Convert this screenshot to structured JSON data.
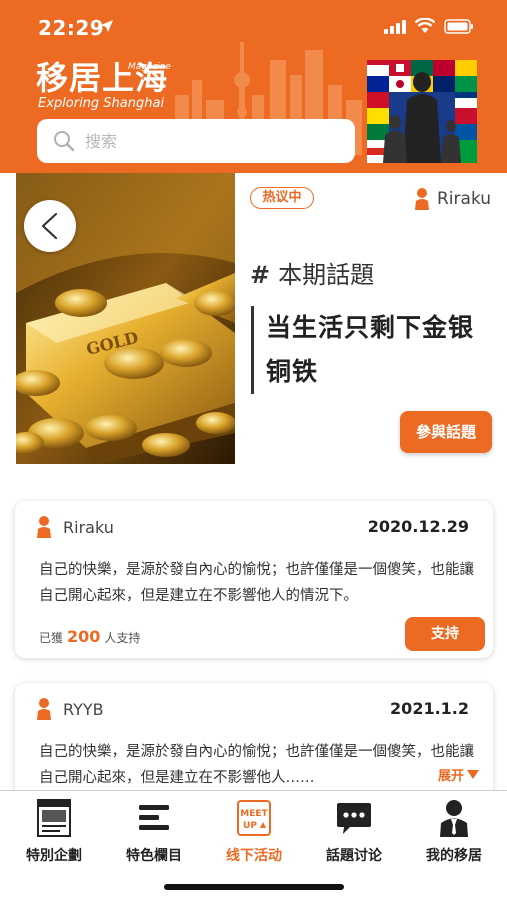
{
  "status_bar": {
    "time": "22:29"
  },
  "brand": {
    "logo_main": "移居上海",
    "logo_magazine": "Magazine",
    "logo_sub": "Exploring Shanghai"
  },
  "search": {
    "placeholder": "搜索"
  },
  "topic": {
    "badge": "热议中",
    "author": "Riraku",
    "issue_label": "本期話題",
    "title": "当生活只剩下金银铜铁",
    "join_label": "參與話題"
  },
  "comments": [
    {
      "user": "Riraku",
      "date": "2020.12.29",
      "text": "自己的快樂，是源於發自內心的愉悅；也許僅僅是一個傻笑，也能讓自己開心起來，但是建立在不影響他人的情況下。",
      "support_prefix": "已獲",
      "support_count": "200",
      "support_suffix": "人支持",
      "support_label": "支持"
    },
    {
      "user": "RYYB",
      "date": "2021.1.2",
      "text": "自己的快樂，是源於發自內心的愉悅；也許僅僅是一個傻笑，也能讓自己開心起來，但是建立在不影響他人……",
      "expand_label": "展开"
    }
  ],
  "tabs": [
    {
      "label": "特別企劃",
      "icon": "magazine-icon"
    },
    {
      "label": "特色欄目",
      "icon": "list-icon"
    },
    {
      "label": "线下活动",
      "icon": "meetup-icon",
      "active": true
    },
    {
      "label": "話題讨论",
      "icon": "chat-bubble-icon"
    },
    {
      "label": "我的移居",
      "icon": "profile-icon"
    }
  ],
  "meetup_icon_text": {
    "line1": "MEET",
    "line2": "UP"
  },
  "colors": {
    "accent": "#ec6a22",
    "text": "#222222",
    "header_bg": "#ec6a22"
  }
}
